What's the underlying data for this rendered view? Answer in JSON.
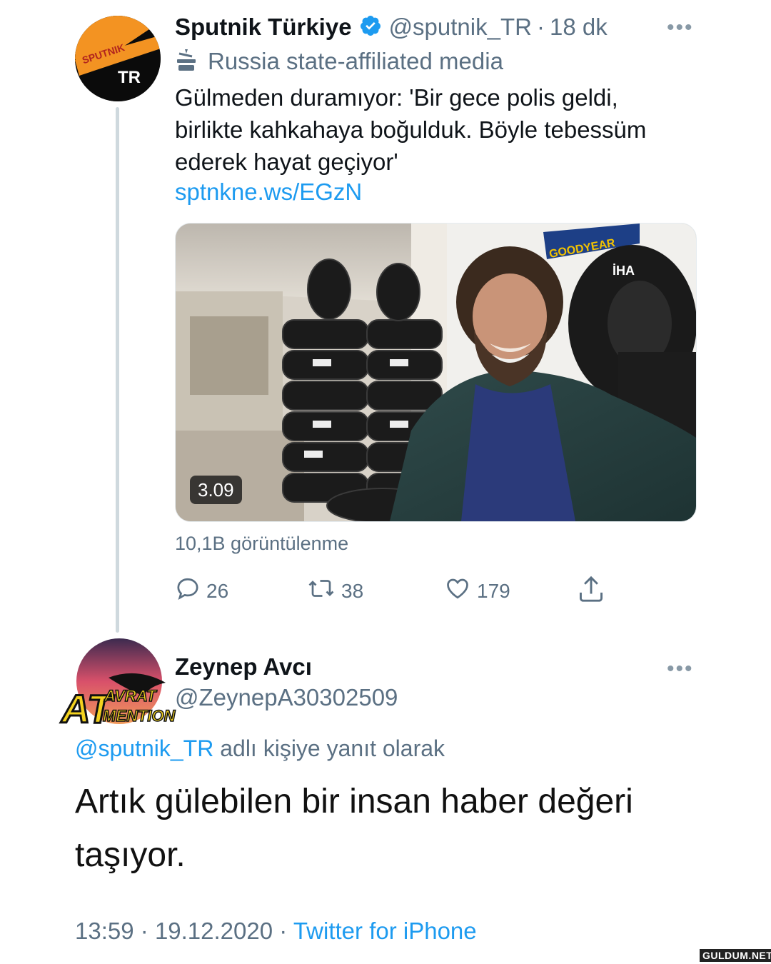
{
  "tweet": {
    "display_name": "Sputnik Türkiye",
    "handle": "@sputnik_TR",
    "separator": "·",
    "time_ago": "18 dk",
    "label": "Russia state-affiliated media",
    "text_lines": [
      "Gülmeden duramıyor: 'Bir gece polis geldi,",
      "birlikte kahkahaya boğulduk. Böyle tebessüm",
      "ederek hayat geçiyor'"
    ],
    "link": "sptnkne.ws/EGzN",
    "avatar_text_top": "SPUTNIK",
    "avatar_text_bottom": "TR",
    "media": {
      "duration": "3.09",
      "watermark": "İHA",
      "banner_text": "GOODYEAR"
    },
    "views": "10,1B görüntülenme",
    "actions": {
      "replies": "26",
      "retweets": "38",
      "likes": "179"
    },
    "icons": [
      "verified-icon",
      "state-media-icon",
      "more-icon",
      "reply-icon",
      "retweet-icon",
      "like-icon",
      "share-icon"
    ]
  },
  "reply": {
    "display_name": "Zeynep Avcı",
    "handle": "@ZeynepA30302509",
    "replying_to_handle": "@sputnik_TR",
    "replying_to_suffix": "adlı kişiye yanıt olarak",
    "text_lines": [
      "Artık gülebilen bir insan haber değeri",
      "taşıyor."
    ],
    "avatar_text_at": "AT",
    "avatar_text_avrat": "AVRAT",
    "avatar_text_mention": "MENTION",
    "time": "13:59",
    "date": "19.12.2020",
    "source": "Twitter for iPhone"
  },
  "watermark": "GULDUM.NET",
  "colors": {
    "link": "#1d9bf0",
    "muted": "#5b7083",
    "sputnik_orange": "#f39322",
    "verified": "#1d9bf0"
  }
}
